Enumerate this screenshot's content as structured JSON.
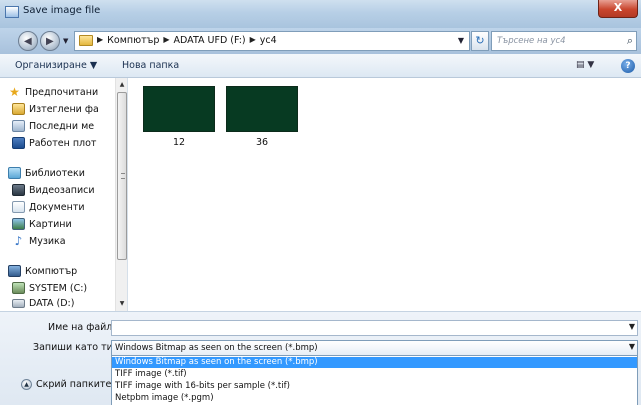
{
  "window": {
    "title": "Save image file",
    "close_label": "X"
  },
  "address": {
    "crumbs": [
      "Компютър",
      "ADATA UFD (F:)",
      "ус4"
    ],
    "search_placeholder": "Търсене на ус4"
  },
  "toolbar": {
    "organize": "Организиране ▼",
    "new_folder": "Нова папка",
    "views": "▤ ▼",
    "help": "?"
  },
  "nav": {
    "favorites_header": "Предпочитани",
    "favorites": [
      "Изтеглени фа",
      "Последни ме",
      "Работен плот"
    ],
    "libraries_header": "Библиотеки",
    "libraries": [
      "Видеозаписи",
      "Документи",
      "Картини",
      "Музика"
    ],
    "computer_header": "Компютър",
    "drives": [
      "SYSTEM (C:)",
      "DATA (D:)"
    ]
  },
  "files": [
    {
      "name": "12"
    },
    {
      "name": "36"
    }
  ],
  "form": {
    "filename_label": "Име на файл:",
    "filename_value": "",
    "type_label": "Запиши като тип:",
    "type_value": "Windows Bitmap as seen on the screen (*.bmp)",
    "type_options": [
      "Windows Bitmap as seen on the screen (*.bmp)",
      "TIFF image (*.tif)",
      "TIFF image with 16-bits per sample (*.tif)",
      "Netpbm image (*.pgm)"
    ],
    "hide_folders": "Скрий папките"
  },
  "colors": {
    "titlebar": "#b7cfe6",
    "selection": "#3399ff",
    "thumbnail": "#073a22"
  }
}
